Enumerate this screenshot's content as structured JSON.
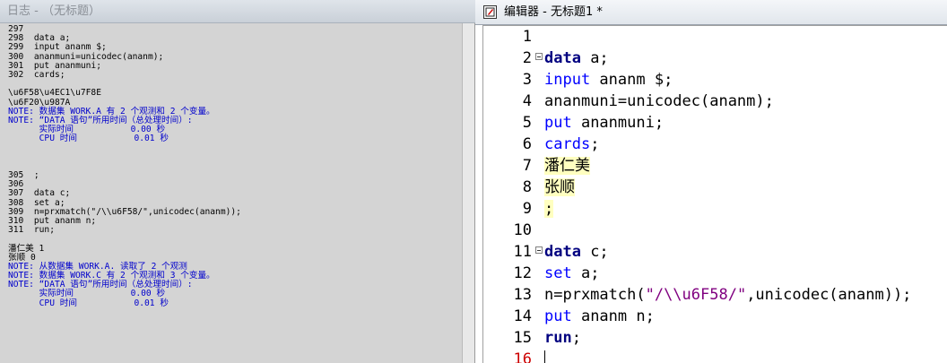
{
  "log": {
    "title": "日志 - （无标题）",
    "lines": [
      {
        "t": "297",
        "k": "source"
      },
      {
        "t": "298  data a;",
        "k": "source"
      },
      {
        "t": "299  input ananm $;",
        "k": "source"
      },
      {
        "t": "300  ananmuni=unicodec(ananm);",
        "k": "source"
      },
      {
        "t": "301  put ananmuni;",
        "k": "source"
      },
      {
        "t": "302  cards;",
        "k": "source"
      },
      {
        "t": "",
        "k": "blank"
      },
      {
        "t": "\\u6F58\\u4EC1\\u7F8E",
        "k": "output"
      },
      {
        "t": "\\u6F20\\u987A",
        "k": "output"
      },
      {
        "t": "NOTE: 数据集 WORK.A 有 2 个观测和 2 个变量。",
        "k": "note"
      },
      {
        "t": "NOTE: “DATA 语句”所用时间（总处理时间）:",
        "k": "note"
      },
      {
        "t": "      实际时间           0.00 秒",
        "k": "note"
      },
      {
        "t": "      CPU 时间           0.01 秒",
        "k": "note"
      },
      {
        "t": "",
        "k": "blank"
      },
      {
        "t": "",
        "k": "blank"
      },
      {
        "t": "",
        "k": "blank"
      },
      {
        "t": "305  ;",
        "k": "source"
      },
      {
        "t": "306",
        "k": "source"
      },
      {
        "t": "307  data c;",
        "k": "source"
      },
      {
        "t": "308  set a;",
        "k": "source"
      },
      {
        "t": "309  n=prxmatch(\"/\\\\u6F58/\",unicodec(ananm));",
        "k": "source"
      },
      {
        "t": "310  put ananm n;",
        "k": "source"
      },
      {
        "t": "311  run;",
        "k": "source"
      },
      {
        "t": "",
        "k": "blank"
      },
      {
        "t": "潘仁美 1",
        "k": "output"
      },
      {
        "t": "张顺 0",
        "k": "output"
      },
      {
        "t": "NOTE: 从数据集 WORK.A. 读取了 2 个观测",
        "k": "note"
      },
      {
        "t": "NOTE: 数据集 WORK.C 有 2 个观测和 3 个变量。",
        "k": "note"
      },
      {
        "t": "NOTE: “DATA 语句”所用时间（总处理时间）:",
        "k": "note"
      },
      {
        "t": "      实际时间           0.00 秒",
        "k": "note"
      },
      {
        "t": "      CPU 时间           0.01 秒",
        "k": "note"
      }
    ]
  },
  "editor": {
    "title": "编辑器 - 无标题1 *",
    "lines": [
      {
        "n": "1",
        "fold": false,
        "segs": []
      },
      {
        "n": "2",
        "fold": true,
        "segs": [
          {
            "t": "data",
            "c": "kw-bold"
          },
          {
            "t": " a;",
            "c": "plain"
          }
        ]
      },
      {
        "n": "3",
        "fold": false,
        "segs": [
          {
            "t": "input",
            "c": "kw-blue"
          },
          {
            "t": " ananm $;",
            "c": "plain"
          }
        ]
      },
      {
        "n": "4",
        "fold": false,
        "segs": [
          {
            "t": "ananmuni=unicodec(ananm);",
            "c": "plain"
          }
        ]
      },
      {
        "n": "5",
        "fold": false,
        "segs": [
          {
            "t": "put",
            "c": "kw-blue"
          },
          {
            "t": " ananmuni;",
            "c": "plain"
          }
        ]
      },
      {
        "n": "6",
        "fold": false,
        "segs": [
          {
            "t": "cards",
            "c": "kw-blue"
          },
          {
            "t": ";",
            "c": "plain"
          }
        ]
      },
      {
        "n": "7",
        "fold": false,
        "segs": [
          {
            "t": "潘仁美",
            "c": "plain cards-data"
          }
        ]
      },
      {
        "n": "8",
        "fold": false,
        "segs": [
          {
            "t": "张顺",
            "c": "plain cards-data"
          }
        ]
      },
      {
        "n": "9",
        "fold": false,
        "segs": [
          {
            "t": ";",
            "c": "plain cards-data"
          }
        ]
      },
      {
        "n": "10",
        "fold": false,
        "segs": []
      },
      {
        "n": "11",
        "fold": true,
        "segs": [
          {
            "t": "data",
            "c": "kw-bold"
          },
          {
            "t": " c;",
            "c": "plain"
          }
        ]
      },
      {
        "n": "12",
        "fold": false,
        "segs": [
          {
            "t": "set",
            "c": "kw-blue"
          },
          {
            "t": " a;",
            "c": "plain"
          }
        ]
      },
      {
        "n": "13",
        "fold": false,
        "segs": [
          {
            "t": "n=prxmatch(",
            "c": "plain"
          },
          {
            "t": "\"/\\\\u6F58/\"",
            "c": "str-purple"
          },
          {
            "t": ",unicodec(ananm));",
            "c": "plain"
          }
        ]
      },
      {
        "n": "14",
        "fold": false,
        "segs": [
          {
            "t": "put",
            "c": "kw-blue"
          },
          {
            "t": " ananm n;",
            "c": "plain"
          }
        ]
      },
      {
        "n": "15",
        "fold": false,
        "segs": [
          {
            "t": "run",
            "c": "kw-bold"
          },
          {
            "t": ";",
            "c": "plain"
          }
        ]
      },
      {
        "n": "16",
        "fold": false,
        "segs": [],
        "cursor": true
      }
    ]
  },
  "colors": {
    "note": "#0000cc",
    "keyword_bold": "#000080",
    "keyword": "#0000ff",
    "string": "#800080",
    "cards_highlight": "#ffffc0"
  },
  "icons": {
    "editor_icon": "sas-editor-icon"
  }
}
